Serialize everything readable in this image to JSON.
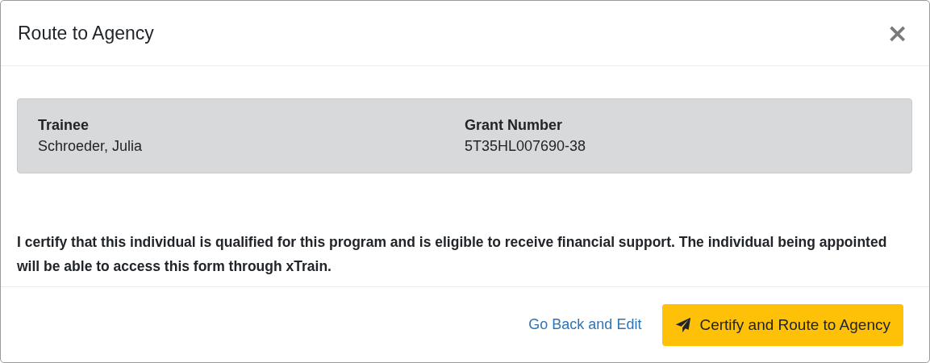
{
  "dialog": {
    "title": "Route to Agency",
    "close_symbol": "×"
  },
  "summary": [
    {
      "label": "Trainee",
      "value": "Schroeder, Julia"
    },
    {
      "label": "Grant Number",
      "value": "5T35HL007690-38"
    }
  ],
  "certification": "I certify that this individual is qualified for this program and is eligible to receive financial support. The individual being appointed will be able to access this form through xTrain.",
  "footer": {
    "back_link": "Go Back and Edit",
    "submit_button": "Certify and Route to Agency"
  }
}
